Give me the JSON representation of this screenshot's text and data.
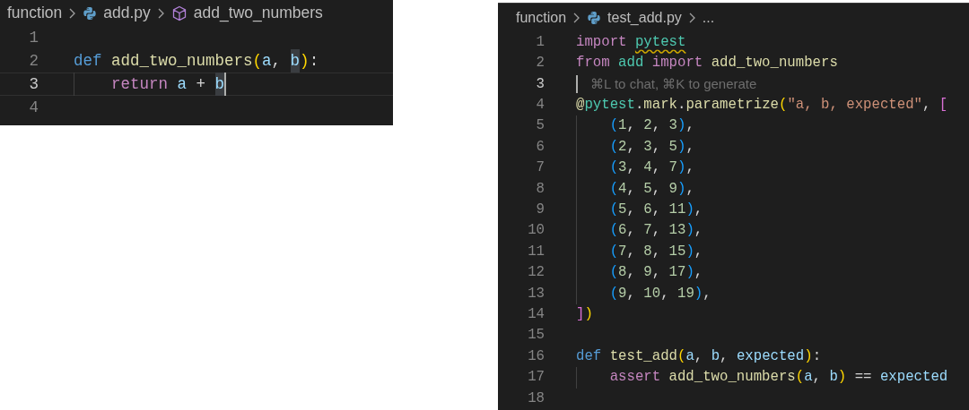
{
  "editors": [
    {
      "breadcrumbs": [
        {
          "kind": "folder",
          "label": "function"
        },
        {
          "kind": "python",
          "label": "add.py"
        },
        {
          "kind": "symbol",
          "label": "add_two_numbers"
        }
      ],
      "lines": [
        {
          "number": "1",
          "current": false,
          "indented": false
        },
        {
          "number": "2",
          "current": false,
          "indented": false,
          "tokens": [
            {
              "kind": "keyword",
              "text": "def "
            },
            {
              "kind": "function",
              "text": "add_two_numbers"
            },
            {
              "kind": "paren",
              "text": "("
            },
            {
              "kind": "variable",
              "text": "a"
            },
            {
              "kind": "plain",
              "text": ", "
            },
            {
              "kind": "variable",
              "text": "b",
              "highlighted": true
            },
            {
              "kind": "paren",
              "text": ")"
            },
            {
              "kind": "plain",
              "text": ":"
            }
          ]
        },
        {
          "number": "3",
          "current": true,
          "indented": true,
          "tokens": [
            {
              "kind": "control",
              "text": "return "
            },
            {
              "kind": "variable",
              "text": "a"
            },
            {
              "kind": "plain",
              "text": " + "
            },
            {
              "kind": "variable",
              "text": "b",
              "highlighted": true,
              "caret": true
            }
          ]
        },
        {
          "number": "4",
          "current": false,
          "indented": false
        }
      ]
    },
    {
      "breadcrumbs": [
        {
          "kind": "folder",
          "label": "function"
        },
        {
          "kind": "python",
          "label": "test_add.py"
        },
        {
          "kind": "more",
          "label": "..."
        }
      ],
      "lines": [
        {
          "number": "1",
          "current": false,
          "indented": false,
          "tokens": [
            {
              "kind": "control",
              "text": "import "
            },
            {
              "kind": "module",
              "text": "pytest",
              "warning": true
            }
          ]
        },
        {
          "number": "2",
          "current": false,
          "indented": false,
          "tokens": [
            {
              "kind": "control",
              "text": "from "
            },
            {
              "kind": "module",
              "text": "add"
            },
            {
              "kind": "control",
              "text": " import "
            },
            {
              "kind": "function",
              "text": "add_two_numbers"
            }
          ]
        },
        {
          "number": "3",
          "current": true,
          "indented": false,
          "cursor": true,
          "tokens": [
            {
              "kind": "hint",
              "text": "⌘L to chat, ⌘K to generate"
            }
          ]
        },
        {
          "number": "4",
          "current": false,
          "indented": false,
          "tokens": [
            {
              "kind": "function",
              "text": "@"
            },
            {
              "kind": "module",
              "text": "pytest"
            },
            {
              "kind": "plain",
              "text": "."
            },
            {
              "kind": "function",
              "text": "mark"
            },
            {
              "kind": "plain",
              "text": "."
            },
            {
              "kind": "function",
              "text": "parametrize"
            },
            {
              "kind": "paren",
              "text": "("
            },
            {
              "kind": "string",
              "text": "\"a, b, expected\""
            },
            {
              "kind": "plain",
              "text": ", "
            },
            {
              "kind": "bracket",
              "text": "["
            }
          ]
        },
        {
          "number": "5",
          "current": false,
          "indented": true,
          "tokens": [
            {
              "kind": "paren2",
              "text": "("
            },
            {
              "kind": "number",
              "text": "1"
            },
            {
              "kind": "plain",
              "text": ", "
            },
            {
              "kind": "number",
              "text": "2"
            },
            {
              "kind": "plain",
              "text": ", "
            },
            {
              "kind": "number",
              "text": "3"
            },
            {
              "kind": "paren2",
              "text": ")"
            },
            {
              "kind": "plain",
              "text": ","
            }
          ]
        },
        {
          "number": "6",
          "current": false,
          "indented": true,
          "tokens": [
            {
              "kind": "paren2",
              "text": "("
            },
            {
              "kind": "number",
              "text": "2"
            },
            {
              "kind": "plain",
              "text": ", "
            },
            {
              "kind": "number",
              "text": "3"
            },
            {
              "kind": "plain",
              "text": ", "
            },
            {
              "kind": "number",
              "text": "5"
            },
            {
              "kind": "paren2",
              "text": ")"
            },
            {
              "kind": "plain",
              "text": ","
            }
          ]
        },
        {
          "number": "7",
          "current": false,
          "indented": true,
          "tokens": [
            {
              "kind": "paren2",
              "text": "("
            },
            {
              "kind": "number",
              "text": "3"
            },
            {
              "kind": "plain",
              "text": ", "
            },
            {
              "kind": "number",
              "text": "4"
            },
            {
              "kind": "plain",
              "text": ", "
            },
            {
              "kind": "number",
              "text": "7"
            },
            {
              "kind": "paren2",
              "text": ")"
            },
            {
              "kind": "plain",
              "text": ","
            }
          ]
        },
        {
          "number": "8",
          "current": false,
          "indented": true,
          "tokens": [
            {
              "kind": "paren2",
              "text": "("
            },
            {
              "kind": "number",
              "text": "4"
            },
            {
              "kind": "plain",
              "text": ", "
            },
            {
              "kind": "number",
              "text": "5"
            },
            {
              "kind": "plain",
              "text": ", "
            },
            {
              "kind": "number",
              "text": "9"
            },
            {
              "kind": "paren2",
              "text": ")"
            },
            {
              "kind": "plain",
              "text": ","
            }
          ]
        },
        {
          "number": "9",
          "current": false,
          "indented": true,
          "tokens": [
            {
              "kind": "paren2",
              "text": "("
            },
            {
              "kind": "number",
              "text": "5"
            },
            {
              "kind": "plain",
              "text": ", "
            },
            {
              "kind": "number",
              "text": "6"
            },
            {
              "kind": "plain",
              "text": ", "
            },
            {
              "kind": "number",
              "text": "11"
            },
            {
              "kind": "paren2",
              "text": ")"
            },
            {
              "kind": "plain",
              "text": ","
            }
          ]
        },
        {
          "number": "10",
          "current": false,
          "indented": true,
          "tokens": [
            {
              "kind": "paren2",
              "text": "("
            },
            {
              "kind": "number",
              "text": "6"
            },
            {
              "kind": "plain",
              "text": ", "
            },
            {
              "kind": "number",
              "text": "7"
            },
            {
              "kind": "plain",
              "text": ", "
            },
            {
              "kind": "number",
              "text": "13"
            },
            {
              "kind": "paren2",
              "text": ")"
            },
            {
              "kind": "plain",
              "text": ","
            }
          ]
        },
        {
          "number": "11",
          "current": false,
          "indented": true,
          "tokens": [
            {
              "kind": "paren2",
              "text": "("
            },
            {
              "kind": "number",
              "text": "7"
            },
            {
              "kind": "plain",
              "text": ", "
            },
            {
              "kind": "number",
              "text": "8"
            },
            {
              "kind": "plain",
              "text": ", "
            },
            {
              "kind": "number",
              "text": "15"
            },
            {
              "kind": "paren2",
              "text": ")"
            },
            {
              "kind": "plain",
              "text": ","
            }
          ]
        },
        {
          "number": "12",
          "current": false,
          "indented": true,
          "tokens": [
            {
              "kind": "paren2",
              "text": "("
            },
            {
              "kind": "number",
              "text": "8"
            },
            {
              "kind": "plain",
              "text": ", "
            },
            {
              "kind": "number",
              "text": "9"
            },
            {
              "kind": "plain",
              "text": ", "
            },
            {
              "kind": "number",
              "text": "17"
            },
            {
              "kind": "paren2",
              "text": ")"
            },
            {
              "kind": "plain",
              "text": ","
            }
          ]
        },
        {
          "number": "13",
          "current": false,
          "indented": true,
          "tokens": [
            {
              "kind": "paren2",
              "text": "("
            },
            {
              "kind": "number",
              "text": "9"
            },
            {
              "kind": "plain",
              "text": ", "
            },
            {
              "kind": "number",
              "text": "10"
            },
            {
              "kind": "plain",
              "text": ", "
            },
            {
              "kind": "number",
              "text": "19"
            },
            {
              "kind": "paren2",
              "text": ")"
            },
            {
              "kind": "plain",
              "text": ","
            }
          ]
        },
        {
          "number": "14",
          "current": false,
          "indented": false,
          "tokens": [
            {
              "kind": "bracket",
              "text": "]"
            },
            {
              "kind": "paren",
              "text": ")"
            }
          ]
        },
        {
          "number": "15",
          "current": false
        },
        {
          "number": "16",
          "current": false,
          "indented": false,
          "tokens": [
            {
              "kind": "keyword",
              "text": "def "
            },
            {
              "kind": "function",
              "text": "test_add"
            },
            {
              "kind": "paren",
              "text": "("
            },
            {
              "kind": "variable",
              "text": "a"
            },
            {
              "kind": "plain",
              "text": ", "
            },
            {
              "kind": "variable",
              "text": "b"
            },
            {
              "kind": "plain",
              "text": ", "
            },
            {
              "kind": "variable",
              "text": "expected"
            },
            {
              "kind": "paren",
              "text": ")"
            },
            {
              "kind": "plain",
              "text": ":"
            }
          ]
        },
        {
          "number": "17",
          "current": false,
          "indented": true,
          "tokens": [
            {
              "kind": "control",
              "text": "assert "
            },
            {
              "kind": "function",
              "text": "add_two_numbers"
            },
            {
              "kind": "paren",
              "text": "("
            },
            {
              "kind": "variable",
              "text": "a"
            },
            {
              "kind": "plain",
              "text": ", "
            },
            {
              "kind": "variable",
              "text": "b"
            },
            {
              "kind": "paren",
              "text": ")"
            },
            {
              "kind": "plain",
              "text": " == "
            },
            {
              "kind": "variable",
              "text": "expected"
            }
          ]
        },
        {
          "number": "18",
          "current": false
        }
      ]
    }
  ]
}
